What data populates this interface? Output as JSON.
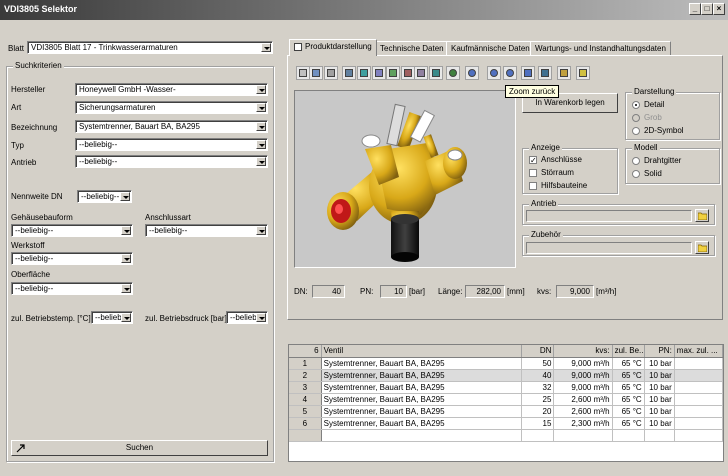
{
  "window": {
    "title": "VDI3805 Selektor",
    "controls": [
      "minimize-icon",
      "maximize-icon",
      "close-icon"
    ]
  },
  "left": {
    "blatt_label": "Blatt",
    "blatt_value": "VDI3805 Blatt 17 - Trinkwasserarmaturen",
    "suchkriterien_legend": "Suchkriterien",
    "hersteller_label": "Hersteller",
    "hersteller_value": "Honeywell GmbH -Wasser-",
    "art_label": "Art",
    "art_value": "Sicherungsarmaturen",
    "bezeichnung_label": "Bezeichnung",
    "bezeichnung_value": "Systemtrenner, Bauart BA, BA295",
    "typ_label": "Typ",
    "typ_value": "--beliebig--",
    "antrieb_label": "Antrieb",
    "antrieb_value": "--beliebig--",
    "nennweite_label": "Nennweite DN",
    "nennweite_value": "--beliebig--",
    "gehaeuse_label": "Gehäusebauform",
    "gehaeuse_value": "--beliebig--",
    "anschluss_label": "Anschlussart",
    "anschluss_value": "--beliebig--",
    "werkstoff_label": "Werkstoff",
    "werkstoff_value": "--beliebig--",
    "oberflaeche_label": "Oberfläche",
    "oberflaeche_value": "--beliebig--",
    "betriebstemp_label": "zul. Betriebstemp. [°C]",
    "betriebstemp_value": "--beliebi",
    "betriebsdruck_label": "zul. Betriebsdruck [bar]",
    "betriebsdruck_value": "--beliebi",
    "search_button": "Suchen"
  },
  "tabs": [
    {
      "label": "Produktdarstellung",
      "icon": "document-icon",
      "active": true
    },
    {
      "label": "Technische Daten"
    },
    {
      "label": "Kaufmännische Daten"
    },
    {
      "label": "Wartungs- und Instandhaltungsdaten"
    }
  ],
  "toolbar": {
    "tooltip": "Zoom zurück",
    "icons": [
      "solid-view-icon",
      "shaded-view-icon",
      "wireframe-view-icon",
      "hidden-line-icon",
      "front-view-icon",
      "top-view-icon",
      "side-view-icon",
      "iso-view-icon",
      "perspective-view-icon",
      "rotate-icon",
      "zoom-in-icon",
      "zoom-out-icon",
      "zoom-back-icon",
      "zoom-window-icon",
      "pan-icon",
      "print-icon",
      "light-icon",
      "cart-icon"
    ]
  },
  "product": {
    "warenkorb_button": "In Warenkorb legen",
    "darstellung_legend": "Darstellung",
    "darstellung_options": [
      {
        "label": "Detail",
        "selected": true,
        "enabled": true
      },
      {
        "label": "Grob",
        "selected": false,
        "enabled": false
      },
      {
        "label": "2D-Symbol",
        "selected": false,
        "enabled": true
      }
    ],
    "anzeige_legend": "Anzeige",
    "anzeige_options": [
      {
        "label": "Anschlüsse",
        "checked": true
      },
      {
        "label": "Störraum",
        "checked": false
      },
      {
        "label": "Hilfsbauteine",
        "checked": false
      }
    ],
    "modell_legend": "Modell",
    "modell_options": [
      {
        "label": "Drahtgitter",
        "selected": false
      },
      {
        "label": "Solid",
        "selected": false
      }
    ],
    "antrieb_legend": "Antrieb",
    "zubehoer_legend": "Zubehör",
    "dn_label": "DN:",
    "dn_value": "40",
    "pn_label": "PN:",
    "pn_value": "10",
    "pn_unit": "[bar]",
    "laenge_label": "Länge:",
    "laenge_value": "282,00",
    "laenge_unit": "[mm]",
    "kvs_label": "kvs:",
    "kvs_value": "9,000",
    "kvs_unit": "[m³/h]"
  },
  "results": {
    "count": "6",
    "columns": [
      "Ventil",
      "DN",
      "kvs:",
      "zul. Be...",
      "PN:",
      "max. zul. ..."
    ],
    "rows": [
      {
        "nr": "1",
        "ventil": "Systemtrenner, Bauart BA, BA295",
        "dn": "50",
        "kvs": "9,000 m³/h",
        "temp": "65 °C",
        "pn": "10 bar",
        "max": ""
      },
      {
        "nr": "2",
        "ventil": "Systemtrenner, Bauart BA, BA295",
        "dn": "40",
        "kvs": "9,000 m³/h",
        "temp": "65 °C",
        "pn": "10 bar",
        "max": ""
      },
      {
        "nr": "3",
        "ventil": "Systemtrenner, Bauart BA, BA295",
        "dn": "32",
        "kvs": "9,000 m³/h",
        "temp": "65 °C",
        "pn": "10 bar",
        "max": ""
      },
      {
        "nr": "4",
        "ventil": "Systemtrenner, Bauart BA, BA295",
        "dn": "25",
        "kvs": "2,600 m³/h",
        "temp": "65 °C",
        "pn": "10 bar",
        "max": ""
      },
      {
        "nr": "5",
        "ventil": "Systemtrenner, Bauart BA, BA295",
        "dn": "20",
        "kvs": "2,600 m³/h",
        "temp": "65 °C",
        "pn": "10 bar",
        "max": ""
      },
      {
        "nr": "6",
        "ventil": "Systemtrenner, Bauart BA, BA295",
        "dn": "15",
        "kvs": "2,300 m³/h",
        "temp": "65 °C",
        "pn": "10 bar",
        "max": ""
      }
    ],
    "selected_row": 2
  },
  "colors": {
    "valve_body": "#e8b820",
    "valve_red": "#d02020",
    "viewport_bg": "#c8c8c8"
  }
}
